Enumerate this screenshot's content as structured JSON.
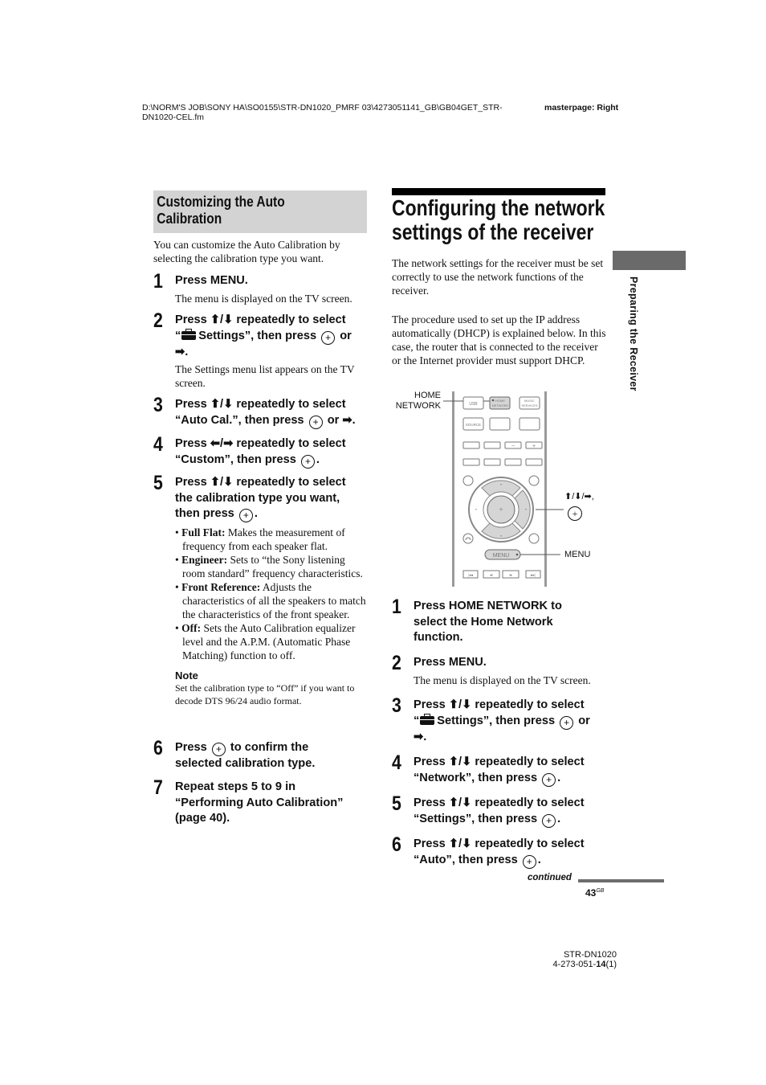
{
  "header": {
    "path_line1": "D:\\NORM'S JOB\\SONY HA\\SO0155\\STR-DN1020_PMRF 03\\4273051141_GB\\GB04GET_STR-",
    "path_line2": "DN1020-CEL.fm",
    "masterpage": "masterpage: Right"
  },
  "left": {
    "section_title_line1": "Customizing the Auto",
    "section_title_line2": "Calibration",
    "intro_line1": "You can customize the Auto Calibration by",
    "intro_line2": "selecting the calibration type you want.",
    "steps": [
      {
        "num": "1",
        "lines": [
          "Press MENU."
        ],
        "sub": [
          "The menu is displayed on the TV screen."
        ]
      },
      {
        "num": "2",
        "lines": [
          "Press ⬆/⬇ repeatedly to select",
          "“",
          "Settings”, then press",
          "or",
          "➡."
        ],
        "sub": [
          "The Settings menu list appears on the TV",
          "screen."
        ]
      },
      {
        "num": "3",
        "lines": [
          "Press ⬆/⬇ repeatedly to select",
          "“Auto Cal.”, then press",
          "or ➡."
        ]
      },
      {
        "num": "4",
        "lines": [
          "Press ⬅/➡ repeatedly to select",
          "“Custom”, then press",
          "."
        ]
      },
      {
        "num": "5",
        "lines": [
          "Press ⬆/⬇ repeatedly to select",
          "the calibration type you want,",
          "then press",
          "."
        ]
      },
      {
        "num": "6",
        "lines": [
          "Press",
          "to confirm the",
          "selected calibration type."
        ]
      },
      {
        "num": "7",
        "lines": [
          "Repeat steps 5 to 9 in",
          "“Performing Auto Calibration”",
          "(page 40)."
        ]
      }
    ],
    "bullets": [
      {
        "term": "Full Flat:",
        "text": " Makes the measurement of frequency from each speaker flat."
      },
      {
        "term": "Engineer:",
        "text": " Sets to “the Sony listening room standard” frequency characteristics."
      },
      {
        "term": "Front Reference:",
        "text": " Adjusts the characteristics of all the speakers to match the characteristics of the front speaker."
      },
      {
        "term": "Off:",
        "text": " Sets the Auto Calibration equalizer level and the A.P.M. (Automatic Phase Matching) function to off."
      }
    ],
    "note_heading": "Note",
    "note_text": "Set the calibration type to “Off” if you want to decode DTS 96/24 audio format."
  },
  "right": {
    "title_line1": "Configuring the network",
    "title_line2": "settings of the receiver",
    "para1": "The network settings for the receiver must be set correctly to use the network functions of the receiver.",
    "para2": "The procedure used to set up the IP address automatically (DHCP) is explained below. In this case, the router that is connected to the receiver or the Internet provider must support DHCP.",
    "side_tab_label": "Preparing the Receiver",
    "remote": {
      "label_home_network_1": "HOME",
      "label_home_network_2": "NETWORK",
      "label_arrows": "⬆/⬇/➡,",
      "label_menu": "MENU",
      "btn_usb": "USB",
      "btn_home_network": "HOME NETWORK",
      "btn_music_services": "MUSIC SERVICES",
      "btn_source": "SOURCE",
      "btn_minus": "−",
      "btn_plus": "+",
      "btn_menu": "MENU"
    },
    "steps": [
      {
        "num": "1",
        "lines": [
          "Press HOME NETWORK to",
          "select the Home Network",
          "function."
        ]
      },
      {
        "num": "2",
        "lines": [
          "Press MENU."
        ],
        "sub": [
          "The menu is displayed on the TV screen."
        ]
      },
      {
        "num": "3",
        "lines": [
          "Press ⬆/⬇ repeatedly to select",
          "“",
          "Settings”, then press",
          "or",
          "➡."
        ]
      },
      {
        "num": "4",
        "lines": [
          "Press ⬆/⬇ repeatedly to select",
          "“Network”, then press",
          "."
        ]
      },
      {
        "num": "5",
        "lines": [
          "Press ⬆/⬇ repeatedly to select",
          "“Settings”, then press",
          "."
        ]
      },
      {
        "num": "6",
        "lines": [
          "Press ⬆/⬇ repeatedly to select",
          "“Auto”, then press",
          "."
        ]
      }
    ],
    "continued": "continued",
    "page_number": "43",
    "page_suffix": "GB"
  },
  "footer": {
    "model": "STR-DN1020",
    "code_prefix": "4-273-051-",
    "code_bold": "14",
    "code_suffix": "(1)"
  }
}
